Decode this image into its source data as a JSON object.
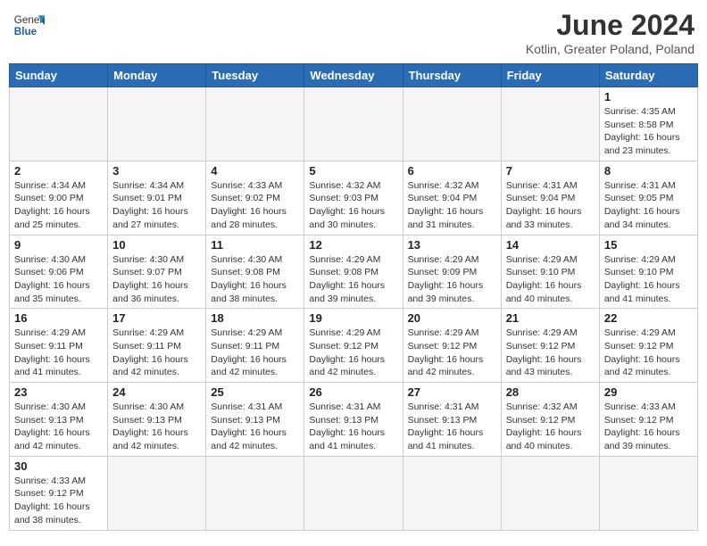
{
  "header": {
    "logo_general": "General",
    "logo_blue": "Blue",
    "month_title": "June 2024",
    "subtitle": "Kotlin, Greater Poland, Poland"
  },
  "weekdays": [
    "Sunday",
    "Monday",
    "Tuesday",
    "Wednesday",
    "Thursday",
    "Friday",
    "Saturday"
  ],
  "weeks": [
    [
      {
        "day": "",
        "info": "",
        "empty": true
      },
      {
        "day": "",
        "info": "",
        "empty": true
      },
      {
        "day": "",
        "info": "",
        "empty": true
      },
      {
        "day": "",
        "info": "",
        "empty": true
      },
      {
        "day": "",
        "info": "",
        "empty": true
      },
      {
        "day": "",
        "info": "",
        "empty": true
      },
      {
        "day": "1",
        "info": "Sunrise: 4:35 AM\nSunset: 8:58 PM\nDaylight: 16 hours and 23 minutes."
      }
    ],
    [
      {
        "day": "2",
        "info": "Sunrise: 4:34 AM\nSunset: 9:00 PM\nDaylight: 16 hours and 25 minutes."
      },
      {
        "day": "3",
        "info": "Sunrise: 4:34 AM\nSunset: 9:01 PM\nDaylight: 16 hours and 27 minutes."
      },
      {
        "day": "4",
        "info": "Sunrise: 4:33 AM\nSunset: 9:02 PM\nDaylight: 16 hours and 28 minutes."
      },
      {
        "day": "5",
        "info": "Sunrise: 4:32 AM\nSunset: 9:03 PM\nDaylight: 16 hours and 30 minutes."
      },
      {
        "day": "6",
        "info": "Sunrise: 4:32 AM\nSunset: 9:04 PM\nDaylight: 16 hours and 31 minutes."
      },
      {
        "day": "7",
        "info": "Sunrise: 4:31 AM\nSunset: 9:04 PM\nDaylight: 16 hours and 33 minutes."
      },
      {
        "day": "8",
        "info": "Sunrise: 4:31 AM\nSunset: 9:05 PM\nDaylight: 16 hours and 34 minutes."
      }
    ],
    [
      {
        "day": "9",
        "info": "Sunrise: 4:30 AM\nSunset: 9:06 PM\nDaylight: 16 hours and 35 minutes."
      },
      {
        "day": "10",
        "info": "Sunrise: 4:30 AM\nSunset: 9:07 PM\nDaylight: 16 hours and 36 minutes."
      },
      {
        "day": "11",
        "info": "Sunrise: 4:30 AM\nSunset: 9:08 PM\nDaylight: 16 hours and 38 minutes."
      },
      {
        "day": "12",
        "info": "Sunrise: 4:29 AM\nSunset: 9:08 PM\nDaylight: 16 hours and 39 minutes."
      },
      {
        "day": "13",
        "info": "Sunrise: 4:29 AM\nSunset: 9:09 PM\nDaylight: 16 hours and 39 minutes."
      },
      {
        "day": "14",
        "info": "Sunrise: 4:29 AM\nSunset: 9:10 PM\nDaylight: 16 hours and 40 minutes."
      },
      {
        "day": "15",
        "info": "Sunrise: 4:29 AM\nSunset: 9:10 PM\nDaylight: 16 hours and 41 minutes."
      }
    ],
    [
      {
        "day": "16",
        "info": "Sunrise: 4:29 AM\nSunset: 9:11 PM\nDaylight: 16 hours and 41 minutes."
      },
      {
        "day": "17",
        "info": "Sunrise: 4:29 AM\nSunset: 9:11 PM\nDaylight: 16 hours and 42 minutes."
      },
      {
        "day": "18",
        "info": "Sunrise: 4:29 AM\nSunset: 9:11 PM\nDaylight: 16 hours and 42 minutes."
      },
      {
        "day": "19",
        "info": "Sunrise: 4:29 AM\nSunset: 9:12 PM\nDaylight: 16 hours and 42 minutes."
      },
      {
        "day": "20",
        "info": "Sunrise: 4:29 AM\nSunset: 9:12 PM\nDaylight: 16 hours and 42 minutes."
      },
      {
        "day": "21",
        "info": "Sunrise: 4:29 AM\nSunset: 9:12 PM\nDaylight: 16 hours and 43 minutes."
      },
      {
        "day": "22",
        "info": "Sunrise: 4:29 AM\nSunset: 9:12 PM\nDaylight: 16 hours and 42 minutes."
      }
    ],
    [
      {
        "day": "23",
        "info": "Sunrise: 4:30 AM\nSunset: 9:13 PM\nDaylight: 16 hours and 42 minutes."
      },
      {
        "day": "24",
        "info": "Sunrise: 4:30 AM\nSunset: 9:13 PM\nDaylight: 16 hours and 42 minutes."
      },
      {
        "day": "25",
        "info": "Sunrise: 4:31 AM\nSunset: 9:13 PM\nDaylight: 16 hours and 42 minutes."
      },
      {
        "day": "26",
        "info": "Sunrise: 4:31 AM\nSunset: 9:13 PM\nDaylight: 16 hours and 41 minutes."
      },
      {
        "day": "27",
        "info": "Sunrise: 4:31 AM\nSunset: 9:13 PM\nDaylight: 16 hours and 41 minutes."
      },
      {
        "day": "28",
        "info": "Sunrise: 4:32 AM\nSunset: 9:12 PM\nDaylight: 16 hours and 40 minutes."
      },
      {
        "day": "29",
        "info": "Sunrise: 4:33 AM\nSunset: 9:12 PM\nDaylight: 16 hours and 39 minutes."
      }
    ],
    [
      {
        "day": "30",
        "info": "Sunrise: 4:33 AM\nSunset: 9:12 PM\nDaylight: 16 hours and 38 minutes."
      },
      {
        "day": "",
        "info": "",
        "empty": true
      },
      {
        "day": "",
        "info": "",
        "empty": true
      },
      {
        "day": "",
        "info": "",
        "empty": true
      },
      {
        "day": "",
        "info": "",
        "empty": true
      },
      {
        "day": "",
        "info": "",
        "empty": true
      },
      {
        "day": "",
        "info": "",
        "empty": true
      }
    ]
  ]
}
